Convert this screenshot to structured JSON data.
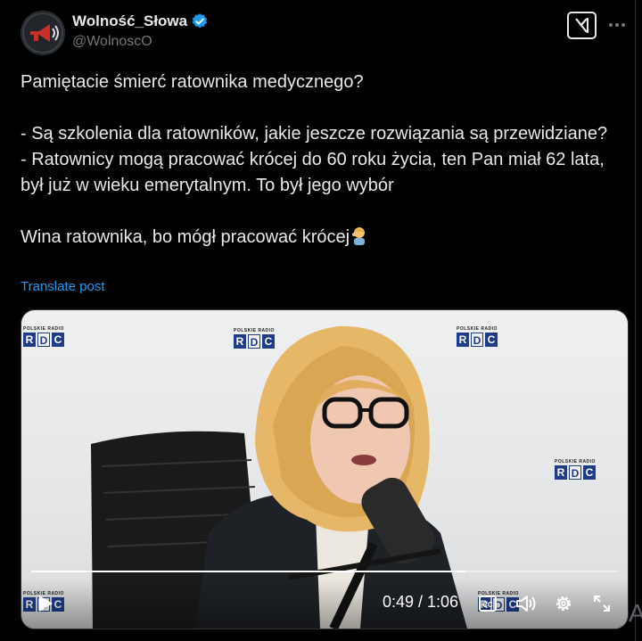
{
  "author": {
    "display_name": "Wolność_Słowa",
    "handle": "@WolnoscO",
    "verified_icon": "verified-badge-icon",
    "avatar_icon": "megaphone-icon"
  },
  "header": {
    "grok_icon": "grok-icon",
    "more_icon": "more-icon"
  },
  "tweet": {
    "line1": "Pamiętacie śmierć ratownika medycznego?",
    "line2": "- Są szkolenia dla ratowników, jakie jeszcze rozwiązania są przewidziane?",
    "line3": "- Ratownicy mogą pracować krócej do 60 roku życia, ten Pan miał 62 lata, był już w wieku emerytalnym. To był jego wybór",
    "line4": "Wina ratownika, bo mógł pracować krócej",
    "emoji": "person-facepalming-emoji",
    "translate": "Translate post"
  },
  "video": {
    "logo_top": "POLSKIE RADIO",
    "logo_letters": [
      "R",
      "D",
      "C"
    ],
    "time_display": "0:49 / 1:06",
    "progress": 0.742,
    "icons": [
      "play-icon",
      "captions-icon",
      "volume-icon",
      "settings-icon",
      "fullscreen-icon"
    ]
  },
  "watermark": "A",
  "colors": {
    "accent": "#1d9bf0",
    "text": "#e7e9ea",
    "muted": "#71767b",
    "background": "#000000"
  }
}
